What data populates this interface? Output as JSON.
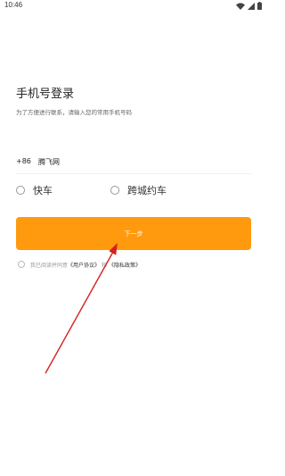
{
  "status_bar": {
    "time": "10:46",
    "icons": [
      "wifi-icon",
      "signal-icon",
      "battery-icon"
    ]
  },
  "login": {
    "title": "手机号登录",
    "subtitle": "为了方便进行联系，请输入您的常用手机号码",
    "country_code": "+86",
    "phone_value": "腾飞网",
    "options": [
      {
        "label": "快车",
        "selected": false
      },
      {
        "label": "跨城约车",
        "selected": false
      }
    ],
    "next_label": "下一步",
    "agreement": {
      "checked": false,
      "prefix": "我已阅读并同意",
      "user_agreement": "《用户协议》",
      "separator": "和",
      "privacy_policy": "《隐私政策》"
    }
  },
  "colors": {
    "accent": "#ff9a0f",
    "annotation_arrow": "#d62020"
  }
}
